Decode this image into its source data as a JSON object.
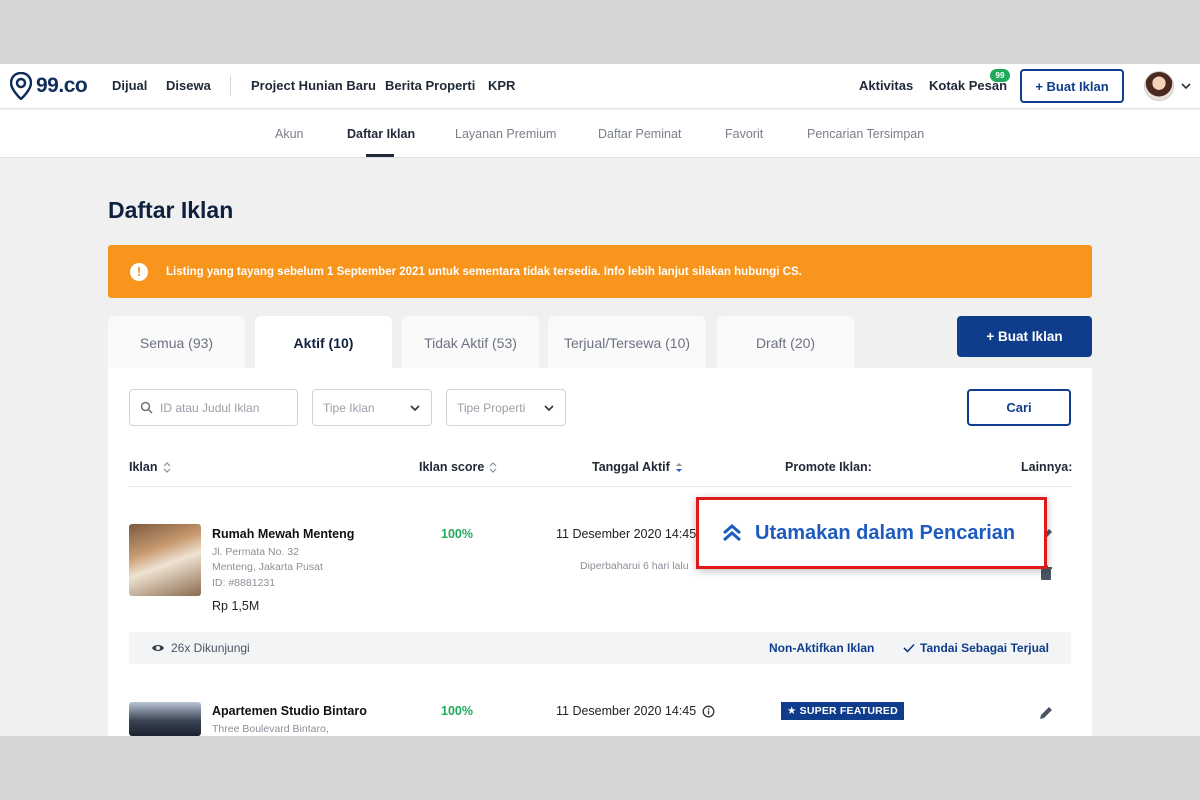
{
  "brand": {
    "name": "99.co"
  },
  "topnav": {
    "links": [
      "Dijual",
      "Disewa",
      "Project Hunian Baru",
      "Berita Properti",
      "KPR"
    ],
    "activity": "Aktivitas",
    "inbox": "Kotak Pesan",
    "inbox_badge": "99",
    "create_ad": "+ Buat Iklan"
  },
  "subnav": {
    "items": [
      "Akun",
      "Daftar Iklan",
      "Layanan Premium",
      "Daftar Peminat",
      "Favorit",
      "Pencarian Tersimpan"
    ],
    "active": "Daftar Iklan"
  },
  "page": {
    "title": "Daftar Iklan",
    "alert": "Listing yang tayang sebelum 1 September 2021 untuk sementara tidak tersedia. Info lebih lanjut silakan hubungi CS."
  },
  "tabs": [
    "Semua (93)",
    "Aktif (10)",
    "Tidak Aktif (53)",
    "Terjual/Tersewa (10)",
    "Draft (20)"
  ],
  "active_tab": "Aktif (10)",
  "create_ad_button": "+ Buat Iklan",
  "filters": {
    "search_placeholder": "ID atau Judul Iklan",
    "type_placeholder": "Tipe Iklan",
    "property_placeholder": "Tipe Properti",
    "search_button": "Cari"
  },
  "table": {
    "headers": {
      "listing": "Iklan",
      "score": "Iklan score",
      "date": "Tanggal Aktif",
      "promote": "Promote Iklan:",
      "more": "Lainnya:"
    },
    "rows": [
      {
        "title": "Rumah Mewah Menteng",
        "address1": "Jl. Permata No. 32",
        "address2": "Menteng, Jakarta Pusat",
        "id": "ID: #8881231",
        "price": "Rp 1,5M",
        "score": "100%",
        "date": "11 Desember 2020 14:45",
        "updated": "Diperbaharui 6 hari lalu",
        "views": "26x Dikunjungi",
        "deactivate": "Non-Aktifkan Iklan",
        "mark_sold": "Tandai Sebagai Terjual"
      },
      {
        "title": "Apartemen Studio Bintaro",
        "address1": "Three Boulevard Bintaro,",
        "score": "100%",
        "date": "11 Desember 2020 14:45",
        "badge": "SUPER FEATURED"
      }
    ]
  },
  "highlight": {
    "text": "Utamakan dalam Pencarian",
    "border_color": "#e0191b"
  },
  "colors": {
    "primary": "#0f3d8c",
    "alert": "#f7951d",
    "success": "#1faa5c"
  }
}
